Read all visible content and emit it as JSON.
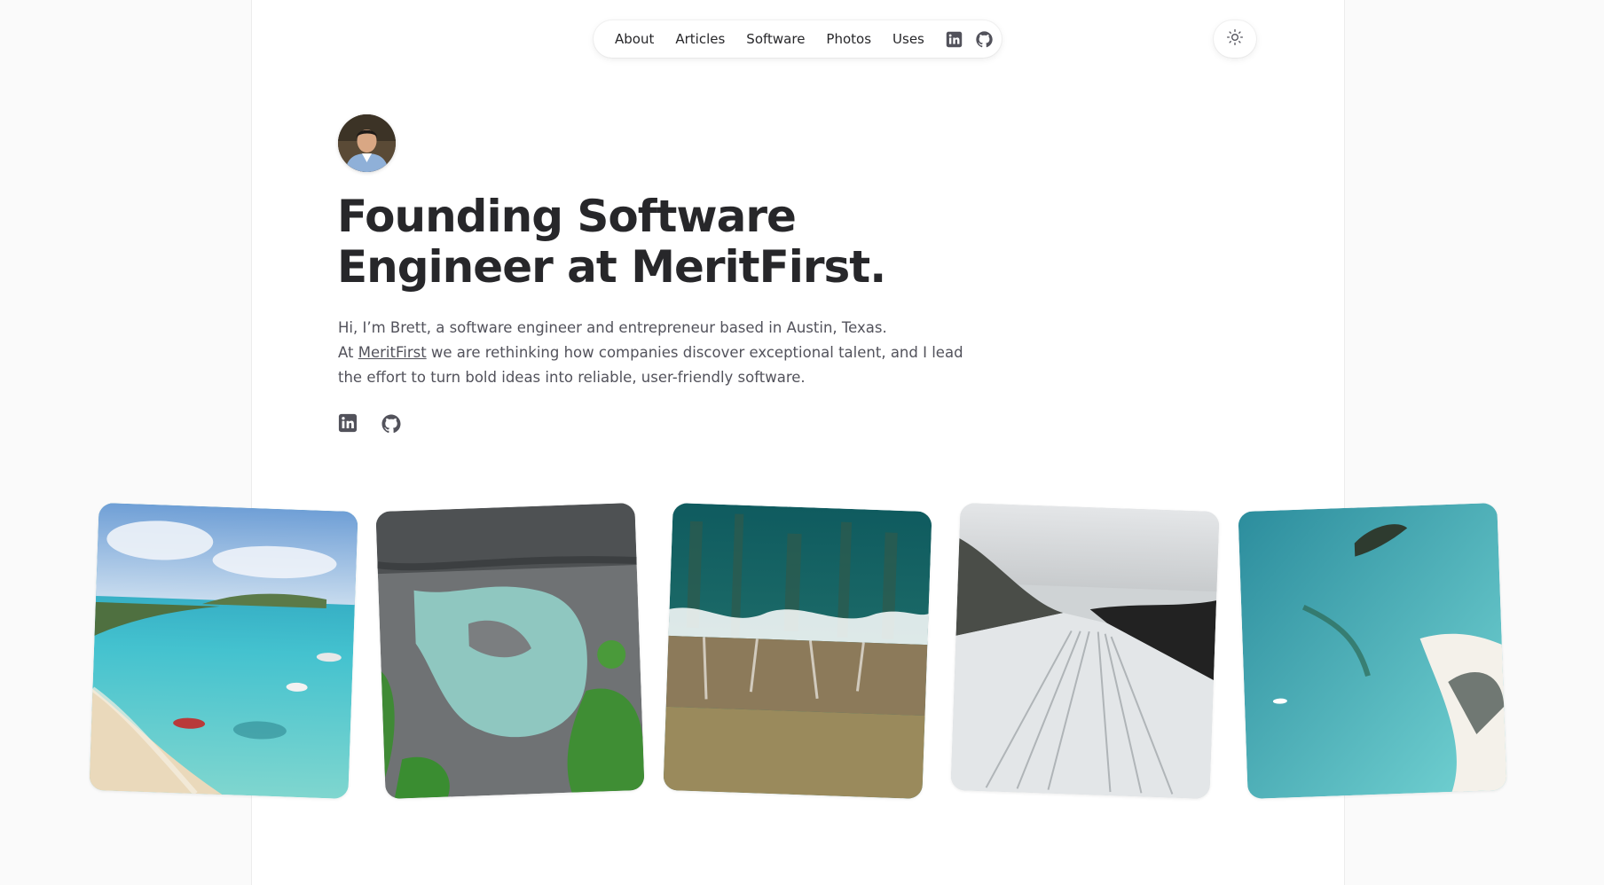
{
  "nav": {
    "links": [
      "About",
      "Articles",
      "Software",
      "Photos",
      "Uses"
    ],
    "icons": [
      "linkedin-icon",
      "github-icon"
    ]
  },
  "theme_toggle": {
    "icon": "sun-icon"
  },
  "hero": {
    "avatar": "avatar",
    "headline": "Founding Software Engineer at MeritFirst.",
    "bio_line1": "Hi, I’m Brett, a software engineer and entrepreneur based in Austin, Texas.",
    "bio_line2_prefix": "At ",
    "bio_link": "MeritFirst",
    "bio_line2_suffix": " we are rethinking how companies discover exceptional talent, and I lead the effort to turn bold ideas into reliable, user-friendly software.",
    "social_icons": [
      "linkedin-icon",
      "github-icon"
    ]
  },
  "photos": [
    {
      "name": "beach-bay-photo"
    },
    {
      "name": "rocky-pool-photo"
    },
    {
      "name": "reef-waves-photo"
    },
    {
      "name": "glacier-photo"
    },
    {
      "name": "turquoise-lagoon-photo"
    }
  ],
  "colors": {
    "text": "#27272a",
    "muted": "#52525b",
    "background": "#fafafa",
    "card": "#ffffff"
  }
}
